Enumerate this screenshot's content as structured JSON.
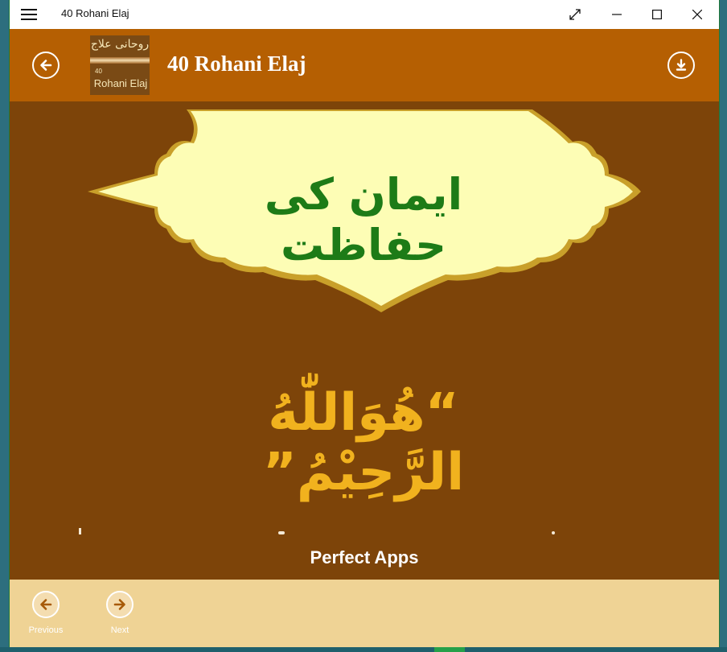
{
  "window": {
    "title": "40 Rohani Elaj",
    "controls": [
      "menu-icon",
      "resize-icon",
      "minimize-icon",
      "maximize-icon",
      "close-icon"
    ]
  },
  "header": {
    "title": "40 Rohani Elaj",
    "logo": {
      "urdu_text": "روحانی علاج",
      "number": "40",
      "english_text": "Rohani Elaj"
    },
    "back_icon": "arrow-left-icon",
    "download_icon": "download-icon"
  },
  "content": {
    "heading": "ایمان کی حفاظت",
    "verse": "“هُوَاللّٰهُ الرَّحِیْمُ”",
    "publisher": "Perfect Apps"
  },
  "footer": {
    "previous_label": "Previous",
    "next_label": "Next"
  },
  "colors": {
    "header_bg": "#b55f02",
    "content_bg": "#7d4409",
    "frame_fill": "#fdfdb5",
    "heading_text": "#1d7b17",
    "verse_text": "#f1b21e",
    "footer_bg": "#efd395"
  }
}
